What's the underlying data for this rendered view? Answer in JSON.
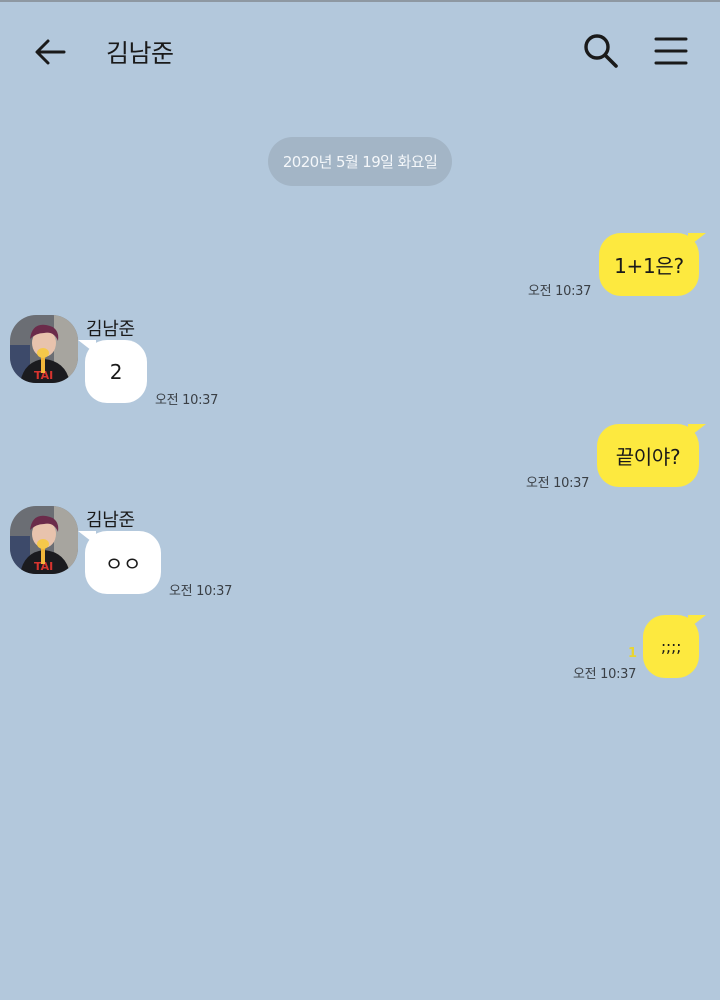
{
  "header": {
    "title": "김남준",
    "back_icon": "arrow-left-icon",
    "search_icon": "search-icon",
    "menu_icon": "hamburger-menu-icon"
  },
  "date_separator": "2020년 5월 19일 화요일",
  "colors": {
    "background": "#b3c8dc",
    "my_bubble": "#fde93f",
    "other_bubble": "#ffffff",
    "date_pill": "#a3b5c6"
  },
  "messages": [
    {
      "sender": "me",
      "text": "1+1은?",
      "time": "오전 10:37"
    },
    {
      "sender": "김남준",
      "text": "2",
      "time": "오전 10:37"
    },
    {
      "sender": "me",
      "text": "끝이야?",
      "time": "오전 10:37"
    },
    {
      "sender": "김남준",
      "text": "ㅇㅇ",
      "time": "오전 10:37"
    },
    {
      "sender": "me",
      "text": ";;;;",
      "time": "오전 10:37",
      "unread_count": "1"
    }
  ]
}
